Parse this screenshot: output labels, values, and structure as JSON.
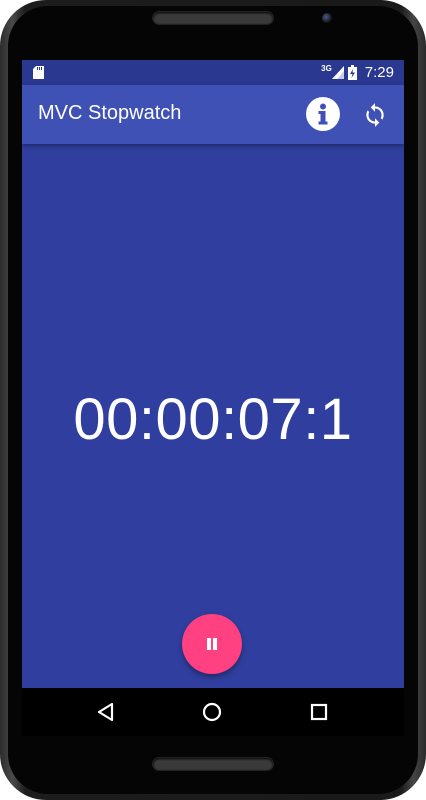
{
  "status_bar": {
    "network": "3G",
    "time": "7:29"
  },
  "app_bar": {
    "title": "MVC Stopwatch"
  },
  "timer": {
    "display": "00:00:07:1"
  },
  "colors": {
    "primary": "#3f51b5",
    "background": "#303f9f",
    "accent": "#ff4081"
  },
  "icons": {
    "sd_card": "sd-card-icon",
    "signal": "signal-icon",
    "battery": "battery-charging-icon",
    "info": "info-icon",
    "refresh": "refresh-icon",
    "pause": "pause-icon",
    "back": "back-triangle-icon",
    "home": "home-circle-icon",
    "recents": "recents-square-icon"
  }
}
